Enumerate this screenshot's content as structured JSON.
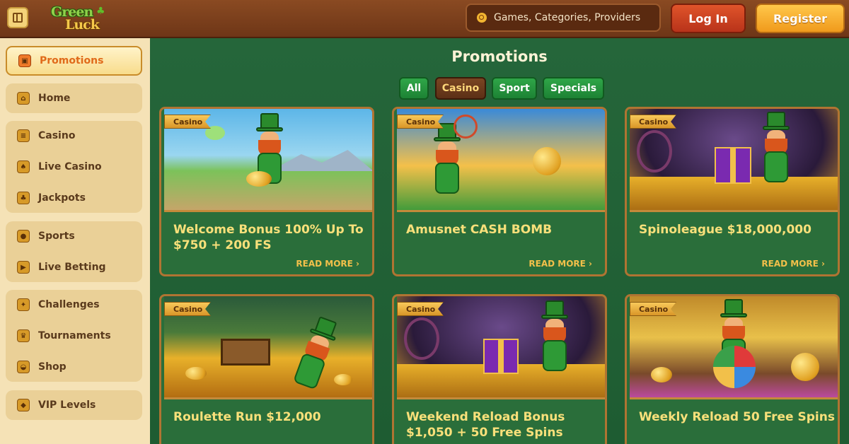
{
  "header": {
    "logo_line1": "Green",
    "logo_line2": "Luck",
    "search_placeholder": "Games, Categories, Providers",
    "login_label": "Log In",
    "register_label": "Register"
  },
  "sidebar": {
    "items": [
      {
        "label": "Promotions",
        "icon": "gift-icon",
        "active": true
      },
      {
        "label": "Home",
        "icon": "home-icon"
      },
      {
        "label": "Casino",
        "icon": "slot-icon"
      },
      {
        "label": "Live Casino",
        "icon": "cards-icon"
      },
      {
        "label": "Jackpots",
        "icon": "clover-icon"
      },
      {
        "label": "Sports",
        "icon": "ball-icon"
      },
      {
        "label": "Live Betting",
        "icon": "live-icon"
      },
      {
        "label": "Challenges",
        "icon": "badge-icon"
      },
      {
        "label": "Tournaments",
        "icon": "trophy-icon"
      },
      {
        "label": "Shop",
        "icon": "basket-icon"
      },
      {
        "label": "VIP Levels",
        "icon": "diamond-icon"
      }
    ]
  },
  "main": {
    "title": "Promotions",
    "filters": [
      {
        "label": "All"
      },
      {
        "label": "Casino",
        "active": true
      },
      {
        "label": "Sport"
      },
      {
        "label": "Specials"
      }
    ],
    "read_more_label": "READ MORE ›",
    "cards": [
      {
        "badge": "Casino",
        "title": "Welcome Bonus 100% Up To $750 + 200 FS"
      },
      {
        "badge": "Casino",
        "title": "Amusnet CASH BOMB"
      },
      {
        "badge": "Casino",
        "title": "Spinoleague $18,000,000"
      },
      {
        "badge": "Casino",
        "title": "Roulette Run $12,000"
      },
      {
        "badge": "Casino",
        "title": "Weekend Reload Bonus $1,050 + 50 Free Spins"
      },
      {
        "badge": "Casino",
        "title": "Weekly Reload 50 Free Spins"
      }
    ]
  },
  "colors": {
    "header_brown": "#7a3e1c",
    "sidebar_cream": "#f5e2b6",
    "main_green": "#1e5c32",
    "accent_gold": "#f9e07a",
    "active_orange": "#e06a1a"
  }
}
